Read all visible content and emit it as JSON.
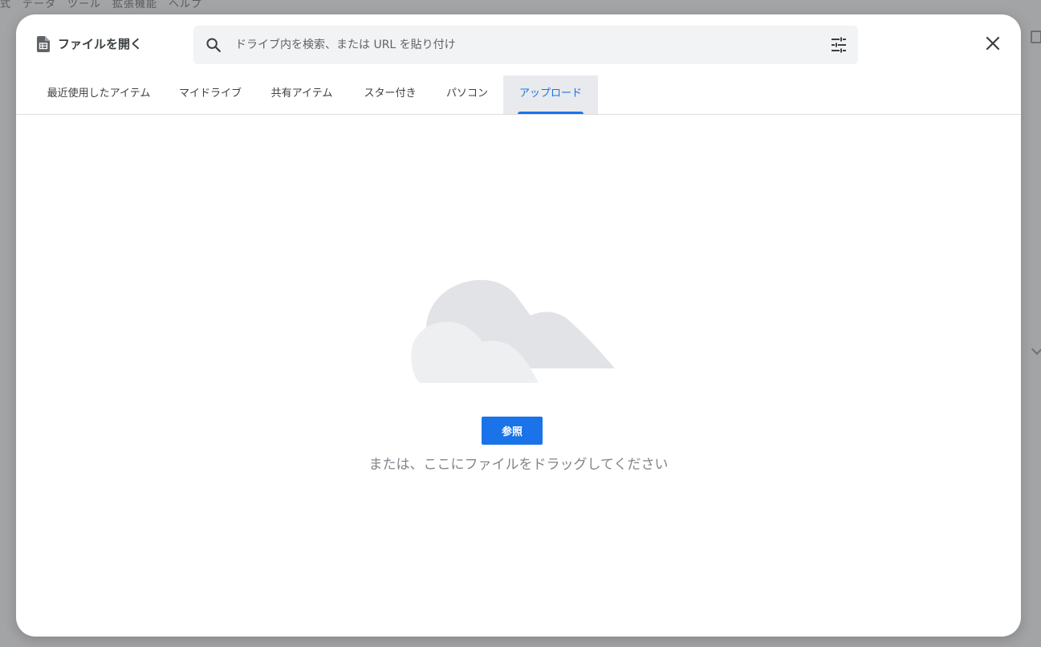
{
  "background": {
    "menu_text": "式　データ　ツール　拡張機能　ヘルプ"
  },
  "dialog": {
    "title": "ファイルを開く",
    "title_icon": "sheets-file-icon",
    "search": {
      "placeholder": "ドライブ内を検索、または URL を貼り付け",
      "value": ""
    },
    "close_icon": "close-icon",
    "tabs": [
      {
        "label": "最近使用したアイテム",
        "active": false
      },
      {
        "label": "マイドライブ",
        "active": false
      },
      {
        "label": "共有アイテム",
        "active": false
      },
      {
        "label": "スター付き",
        "active": false
      },
      {
        "label": "パソコン",
        "active": false
      },
      {
        "label": "アップロード",
        "active": true
      }
    ],
    "upload": {
      "browse_label": "参照",
      "drop_hint": "または、ここにファイルをドラッグしてください"
    }
  },
  "colors": {
    "accent": "#1a73e8",
    "tab_active_bg": "#e8eaed",
    "search_bg": "#f1f3f4",
    "cloud": "#e0e1e5"
  }
}
